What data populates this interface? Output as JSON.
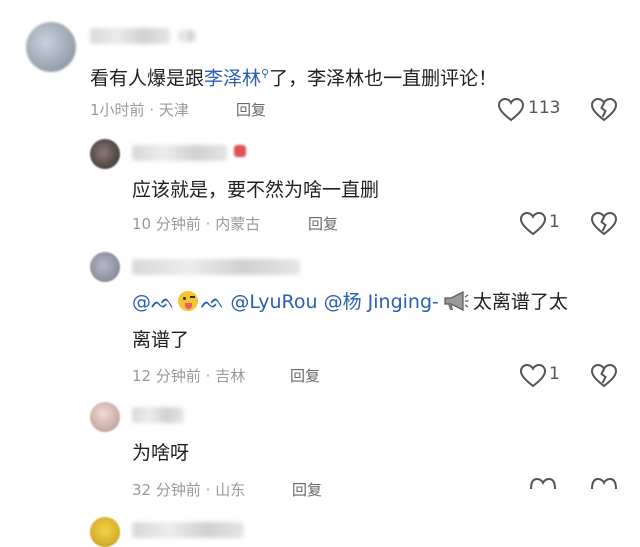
{
  "comments": [
    {
      "text_before": "看有人爆是跟",
      "mention": "李泽林",
      "text_after": "了，李泽林也一直删评论！",
      "time": "1小时前",
      "location": "天津",
      "reply": "回复",
      "likes": "113"
    },
    {
      "text": "应该就是，要不然为啥一直删",
      "time": "10 分钟前",
      "location": "内蒙古",
      "reply": "回复",
      "likes": "1"
    },
    {
      "mentions": [
        "@ᨒ",
        "ᨒ",
        "@LyuRou",
        "@杨 Jinging-"
      ],
      "text_tail": "太离谱了太",
      "text_line2": "离谱了",
      "time": "12 分钟前",
      "location": "吉林",
      "reply": "回复",
      "likes": "1"
    },
    {
      "text": "为啥呀",
      "time": "32 分钟前",
      "location": "山东",
      "reply": "回复"
    }
  ],
  "sep": "·",
  "colors": {
    "link": "#2a5fb5",
    "meta": "#9a9a9a",
    "heart_stroke": "#555555"
  }
}
